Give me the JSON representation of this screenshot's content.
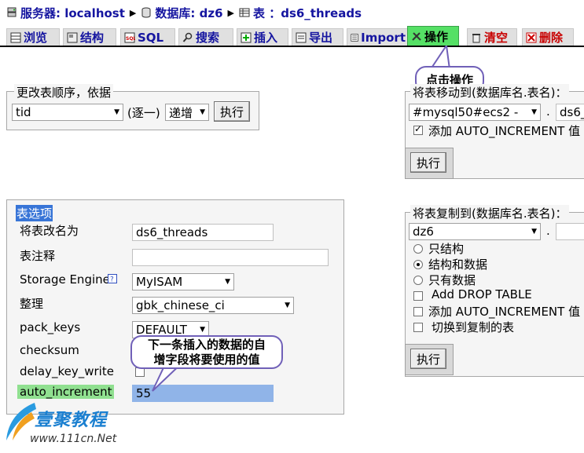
{
  "breadcrumb": {
    "server_label": "服务器: localhost",
    "db_label": "数据库: dz6",
    "table_label": "表 ：ds6_threads"
  },
  "tabs": [
    {
      "label": "浏览",
      "icon": "browse-icon"
    },
    {
      "label": "结构",
      "icon": "structure-icon"
    },
    {
      "label": "SQL",
      "icon": "sql-icon"
    },
    {
      "label": "搜索",
      "icon": "search-icon"
    },
    {
      "label": "插入",
      "icon": "insert-icon"
    },
    {
      "label": "导出",
      "icon": "export-icon"
    },
    {
      "label": "Import",
      "icon": "import-icon"
    },
    {
      "label": "操作",
      "icon": "operations-icon",
      "active": true
    },
    {
      "label": "清空",
      "icon": "empty-icon"
    },
    {
      "label": "删除",
      "icon": "drop-icon"
    }
  ],
  "callouts": {
    "click_operations": "点击操作",
    "auto_increment_note_line1": "下一条插入的数据的自",
    "auto_increment_note_line2": "增字段将要使用的值"
  },
  "order_panel": {
    "legend": "更改表顺序，依据",
    "field_value": "tid",
    "single_label": "(逐一)",
    "direction_value": "递增",
    "execute_label": "执行"
  },
  "move_panel": {
    "legend": "将表移动到(数据库名.表名)：",
    "db_value": "#mysql50#ecs2 -",
    "dot": ".",
    "table_value": "ds6_",
    "auto_increment_label": "添加 AUTO_INCREMENT 值",
    "execute_label": "执行"
  },
  "options_panel": {
    "legend": "表选项",
    "rename_label": "将表改名为",
    "rename_value": "ds6_threads",
    "comment_label": "表注释",
    "comment_value": "",
    "engine_label": "Storage Engine",
    "engine_value": "MyISAM",
    "collation_label": "整理",
    "collation_value": "gbk_chinese_ci",
    "pack_keys_label": "pack_keys",
    "pack_keys_value": "DEFAULT",
    "checksum_label": "checksum",
    "delay_key_write_label": "delay_key_write",
    "auto_increment_label": "auto_increment",
    "auto_increment_value": "55"
  },
  "copy_panel": {
    "legend": "将表复制到(数据库名.表名)：",
    "db_value": "dz6",
    "dot": ".",
    "opt_structure_only": "只结构",
    "opt_structure_data": "结构和数据",
    "opt_data_only": "只有数据",
    "add_drop_table": "Add DROP TABLE",
    "add_auto_increment": "添加 AUTO_INCREMENT 值",
    "switch_to_copied": "切换到复制的表",
    "execute_label": "执行"
  },
  "watermark": {
    "brand": "壹聚教程",
    "url": "www.111cn.Net"
  }
}
